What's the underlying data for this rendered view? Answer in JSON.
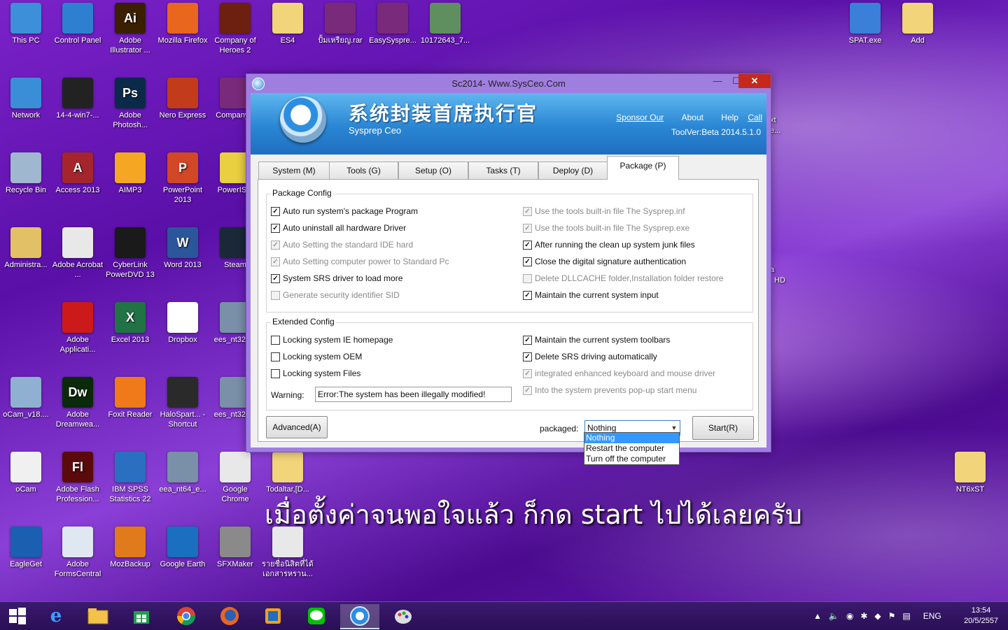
{
  "desktop_icons": [
    {
      "label": "This PC",
      "icon": "computer-icon",
      "color": "#3c8fd8"
    },
    {
      "label": "Control Panel",
      "icon": "control-panel-icon",
      "color": "#2f7fd0"
    },
    {
      "label": "Adobe Illustrator ...",
      "icon": "illustrator-icon",
      "color": "#3a1f00",
      "glyph": "Ai"
    },
    {
      "label": "Mozilla Firefox",
      "icon": "firefox-icon",
      "color": "#e8661e"
    },
    {
      "label": "Company of Heroes 2",
      "icon": "company-of-heroes-icon",
      "color": "#6d1f10"
    },
    {
      "label": "ES4",
      "icon": "folder-icon",
      "color": "#f2d47a"
    },
    {
      "label": "ปั้มเหรียญ.rar",
      "icon": "winrar-archive-icon",
      "color": "#7a2a7a"
    },
    {
      "label": "EasySyspre...",
      "icon": "winrar-archive-icon",
      "color": "#7a2a7a"
    },
    {
      "label": "10172643_7...",
      "icon": "image-file-icon",
      "color": "#5f8f5f"
    },
    {
      "label": "SPAT.exe",
      "icon": "exe-shield-icon",
      "color": "#3a7fd8"
    },
    {
      "label": "Add",
      "icon": "folder-icon",
      "color": "#f2d47a"
    },
    {
      "label": "Network",
      "icon": "network-icon",
      "color": "#3a8ed8"
    },
    {
      "label": "14-4-win7-...",
      "icon": "shield-file-icon",
      "color": "#222222"
    },
    {
      "label": "Adobe Photosh...",
      "icon": "photoshop-icon",
      "color": "#0b2a4a",
      "glyph": "Ps"
    },
    {
      "label": "Nero Express",
      "icon": "nero-icon",
      "color": "#c23b1a"
    },
    {
      "label": "Company...",
      "icon": "winrar-archive-icon",
      "color": "#7a2a7a"
    },
    {
      "label": "Recycle Bin",
      "icon": "recycle-bin-icon",
      "color": "#9fb7cf"
    },
    {
      "label": "Access 2013",
      "icon": "access-icon",
      "color": "#a4262c",
      "glyph": "A"
    },
    {
      "label": "AIMP3",
      "icon": "aimp-icon",
      "color": "#f5a623"
    },
    {
      "label": "PowerPoint 2013",
      "icon": "powerpoint-icon",
      "color": "#d24726",
      "glyph": "P"
    },
    {
      "label": "PowerIS...",
      "icon": "disc-icon",
      "color": "#e8d040"
    },
    {
      "label": "Administra...",
      "icon": "user-folder-icon",
      "color": "#e2c066"
    },
    {
      "label": "Adobe Acrobat ...",
      "icon": "acrobat-icon",
      "color": "#e8e8e8"
    },
    {
      "label": "CyberLink PowerDVD 13",
      "icon": "powerdvd-icon",
      "color": "#1a1a1a"
    },
    {
      "label": "Word 2013",
      "icon": "word-icon",
      "color": "#2b579a",
      "glyph": "W"
    },
    {
      "label": "Steam",
      "icon": "steam-icon",
      "color": "#1b2838"
    },
    {
      "label": "Adobe Applicati...",
      "icon": "adobe-app-icon",
      "color": "#cc1a1a"
    },
    {
      "label": "Excel 2013",
      "icon": "excel-icon",
      "color": "#217346",
      "glyph": "X"
    },
    {
      "label": "Dropbox",
      "icon": "dropbox-icon",
      "color": "#ffffff"
    },
    {
      "label": "ees_nt32_...",
      "icon": "installer-icon",
      "color": "#7a8fa8"
    },
    {
      "label": "oCam_v18....",
      "icon": "installer-icon",
      "color": "#8fb0d0"
    },
    {
      "label": "Adobe Dreamwea...",
      "icon": "dreamweaver-icon",
      "color": "#0b2a0b",
      "glyph": "Dw"
    },
    {
      "label": "Foxit Reader",
      "icon": "foxit-icon",
      "color": "#f07a1a"
    },
    {
      "label": "HaloSpart... - Shortcut",
      "icon": "halo-icon",
      "color": "#2a2a2a"
    },
    {
      "label": "ees_nt32_...",
      "icon": "installer-icon",
      "color": "#7a8fa8"
    },
    {
      "label": "oCam",
      "icon": "ocam-icon",
      "color": "#f0f0f0"
    },
    {
      "label": "Adobe Flash Profession...",
      "icon": "flash-icon",
      "color": "#5a0a0a",
      "glyph": "Fl"
    },
    {
      "label": "IBM SPSS Statistics 22",
      "icon": "spss-icon",
      "color": "#2a6fc0"
    },
    {
      "label": "eea_nt64_e...",
      "icon": "installer-icon",
      "color": "#7a8fa8"
    },
    {
      "label": "Google Chrome",
      "icon": "chrome-icon",
      "color": "#e8e8e8"
    },
    {
      "label": "Todaltar,[D...",
      "icon": "folder-icon",
      "color": "#f2d47a"
    },
    {
      "label": "NT6xST",
      "icon": "folder-icon",
      "color": "#f2d47a"
    },
    {
      "label": "EagleGet",
      "icon": "eagleget-icon",
      "color": "#1a5fb0"
    },
    {
      "label": "Adobe FormsCentral",
      "icon": "forms-icon",
      "color": "#dfe8f0"
    },
    {
      "label": "MozBackup",
      "icon": "mozbackup-icon",
      "color": "#e07a1a"
    },
    {
      "label": "Google Earth",
      "icon": "google-earth-icon",
      "color": "#1a6fc0"
    },
    {
      "label": "SFXMaker",
      "icon": "sfxmaker-icon",
      "color": "#8a8a8a"
    },
    {
      "label": "รายชื่อนิสิตที่ได้ เอกสารหราน...",
      "icon": "pdf-file-icon",
      "color": "#e8e8e8"
    }
  ],
  "behind_window_labels": {
    "right_a": "xt",
    "right_b": "e...",
    "right_c": "a",
    "right_d": "HD"
  },
  "window": {
    "title": "Sc2014- Www.SysCeo.Com",
    "banner_cn": "系统封装首席执行官",
    "banner_en": "Sysprep  Ceo",
    "links": {
      "sponsor": "Sponsor Our",
      "about": "About",
      "help": "Help",
      "call": "Call"
    },
    "version": "ToolVer:Beta 2014.5.1.0",
    "tabs": [
      "System (M)",
      "Tools (G)",
      "Setup (O)",
      "Tasks (T)",
      "Deploy (D)",
      "Package (P)"
    ],
    "active_tab": "Package (P)",
    "package_config": {
      "title": "Package Config",
      "left": [
        {
          "label": "Auto run system's package Program",
          "checked": true,
          "enabled": true
        },
        {
          "label": "Auto uninstall all hardware Driver",
          "checked": true,
          "enabled": true
        },
        {
          "label": "Auto Setting the standard IDE hard",
          "checked": true,
          "enabled": false
        },
        {
          "label": "Auto Setting computer power to Standard Pc",
          "checked": true,
          "enabled": false
        },
        {
          "label": "System SRS driver to load more",
          "checked": true,
          "enabled": true
        },
        {
          "label": "Generate security identifier SID",
          "checked": false,
          "enabled": false
        }
      ],
      "right": [
        {
          "label": "Use the tools built-in file The Sysprep.inf",
          "checked": true,
          "enabled": false
        },
        {
          "label": "Use the tools built-in file The Sysprep.exe",
          "checked": true,
          "enabled": false
        },
        {
          "label": "After running the clean up system junk files",
          "checked": true,
          "enabled": true
        },
        {
          "label": "Close the digital signature authentication",
          "checked": true,
          "enabled": true
        },
        {
          "label": "Delete DLLCACHE folder,Installation folder restore",
          "checked": false,
          "enabled": false
        },
        {
          "label": "Maintain the current system input",
          "checked": true,
          "enabled": true
        }
      ]
    },
    "extended_config": {
      "title": "Extended Config",
      "left": [
        {
          "label": "Locking system IE homepage",
          "checked": false,
          "enabled": true
        },
        {
          "label": "Locking system OEM",
          "checked": false,
          "enabled": true
        },
        {
          "label": "Locking system Files",
          "checked": false,
          "enabled": true
        }
      ],
      "right": [
        {
          "label": "Maintain the current system toolbars",
          "checked": true,
          "enabled": true
        },
        {
          "label": "Delete SRS driving automatically",
          "checked": true,
          "enabled": true
        },
        {
          "label": "integrated enhanced keyboard and mouse driver",
          "checked": true,
          "enabled": false
        },
        {
          "label": "Into the system prevents pop-up start menu",
          "checked": true,
          "enabled": false
        }
      ],
      "warning_label": "Warning:",
      "warning_value": "Error:The system has been illegally modified!"
    },
    "advanced_button": "Advanced(A)",
    "packaged_label": "packaged:",
    "packaged_value": "Nothing",
    "packaged_options": [
      "Nothing",
      "Restart the computer",
      "Turn off the computer"
    ],
    "start_button": "Start(R)"
  },
  "caption": "เมื่อตั้งค่าจนพอใจแล้ว ก็กด start ไปได้เลยครับ",
  "taskbar": {
    "items": [
      "start-icon",
      "internet-explorer-icon",
      "file-explorer-icon",
      "store-icon",
      "chrome-icon",
      "firefox-icon",
      "outlook-icon",
      "line-icon",
      "sysceo-icon",
      "paint-icon"
    ],
    "language": "ENG",
    "time": "13:54",
    "date": "20/5/2557"
  }
}
